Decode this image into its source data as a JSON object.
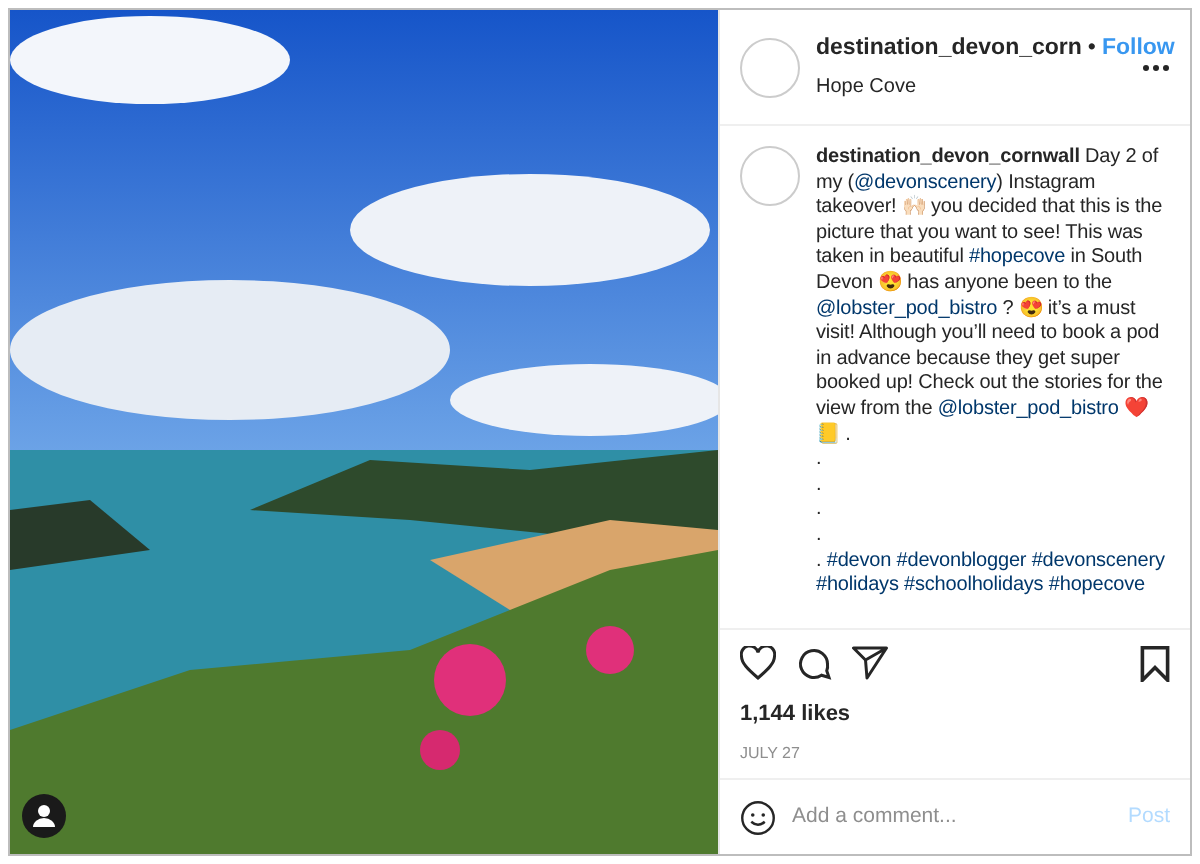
{
  "post": {
    "username": "destination_devon_corn",
    "separator": "•",
    "follow": "Follow",
    "location": "Hope Cove"
  },
  "caption": {
    "username": "destination_devon_cornwall",
    "segments": [
      {
        "kind": "text",
        "text": " Day 2 of my ("
      },
      {
        "kind": "link",
        "text": "@devonscenery"
      },
      {
        "kind": "text",
        "text": ") Instagram takeover! 🙌🏻 you decided that this is the picture that you want to see! This was taken in beautiful "
      },
      {
        "kind": "link",
        "text": "#hopecove"
      },
      {
        "kind": "text",
        "text": " in South Devon 😍 has anyone been to the "
      },
      {
        "kind": "link",
        "text": "@lobster_pod_bistro"
      },
      {
        "kind": "text",
        "text": " ? 😍 it’s a must visit! Although you’ll need to book a pod in advance because they get super booked up! Check out the stories for the view from the "
      },
      {
        "kind": "link",
        "text": "@lobster_pod_bistro"
      },
      {
        "kind": "text",
        "text": " ❤️ 📒 ."
      }
    ],
    "dots": [
      ".",
      ".",
      ".",
      "."
    ],
    "tags_prefix": ".",
    "tags": [
      "#devon",
      "#devonblogger",
      "#devonscenery",
      "#holidays",
      "#schoolholidays",
      "#hopecove"
    ]
  },
  "likes": "1,144 likes",
  "date": "JULY 27",
  "comment": {
    "placeholder": "Add a comment...",
    "post": "Post"
  }
}
